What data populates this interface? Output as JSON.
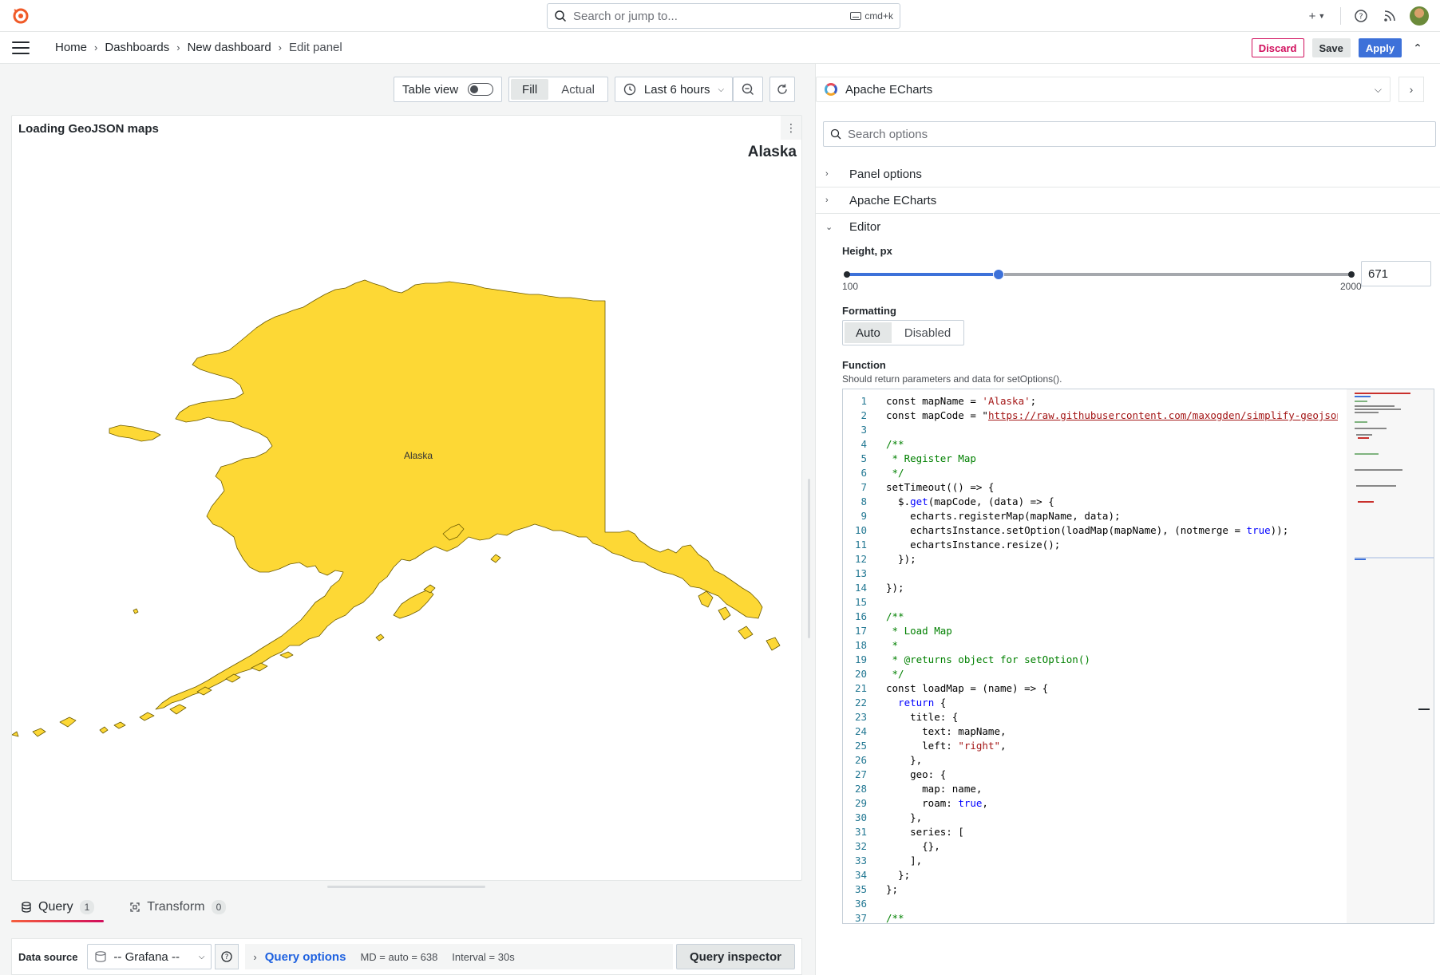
{
  "topbar": {
    "search_placeholder": "Search or jump to...",
    "search_shortcut": "cmd+k",
    "icons": [
      "plus-icon",
      "help-icon",
      "news-icon",
      "avatar"
    ]
  },
  "breadcrumb": {
    "items": [
      "Home",
      "Dashboards",
      "New dashboard",
      "Edit panel"
    ]
  },
  "actions": {
    "discard": "Discard",
    "save": "Save",
    "apply": "Apply"
  },
  "toolbar": {
    "table_view": "Table view",
    "fill": "Fill",
    "actual": "Actual",
    "time_range": "Last 6 hours"
  },
  "panel": {
    "title": "Loading GeoJSON maps",
    "map_title": "Alaska",
    "region_label": "Alaska",
    "fill_color": "#fdd835"
  },
  "query_tabs": {
    "query_label": "Query",
    "query_count": "1",
    "transform_label": "Transform",
    "transform_count": "0"
  },
  "query_row": {
    "data_source_label": "Data source",
    "data_source_value": "-- Grafana --",
    "query_options": "Query options",
    "md": "MD = auto = 638",
    "interval": "Interval = 30s",
    "query_inspector": "Query inspector"
  },
  "options": {
    "visualization": "Apache ECharts",
    "search_placeholder": "Search options",
    "sections": [
      "Panel options",
      "Apache ECharts",
      "Editor"
    ],
    "height_label": "Height, px",
    "height_min": "100",
    "height_max": "2000",
    "height_value": "671",
    "height_fraction": 0.3,
    "formatting_label": "Formatting",
    "formatting_options": [
      "Auto",
      "Disabled"
    ],
    "function_label": "Function",
    "function_desc": "Should return parameters and data for setOptions()."
  },
  "code_lines": [
    "const mapName = 'Alaska';",
    "const mapCode = \"https://raw.githubusercontent.com/maxogden/simplify-geojson/mas",
    "",
    "/**",
    " * Register Map",
    " */",
    "setTimeout(() => {",
    "  $.get(mapCode, (data) => {",
    "    echarts.registerMap(mapName, data);",
    "    echartsInstance.setOption(loadMap(mapName), (notmerge = true));",
    "    echartsInstance.resize();",
    "  });",
    "",
    "});",
    "",
    "/**",
    " * Load Map",
    " *",
    " * @returns object for setOption()",
    " */",
    "const loadMap = (name) => {",
    "  return {",
    "    title: {",
    "      text: mapName,",
    "      left: \"right\",",
    "    },",
    "    geo: {",
    "      map: name,",
    "      roam: true,",
    "    },",
    "    series: [",
    "      {},",
    "    ],",
    "  };",
    "};",
    "",
    "/**"
  ]
}
